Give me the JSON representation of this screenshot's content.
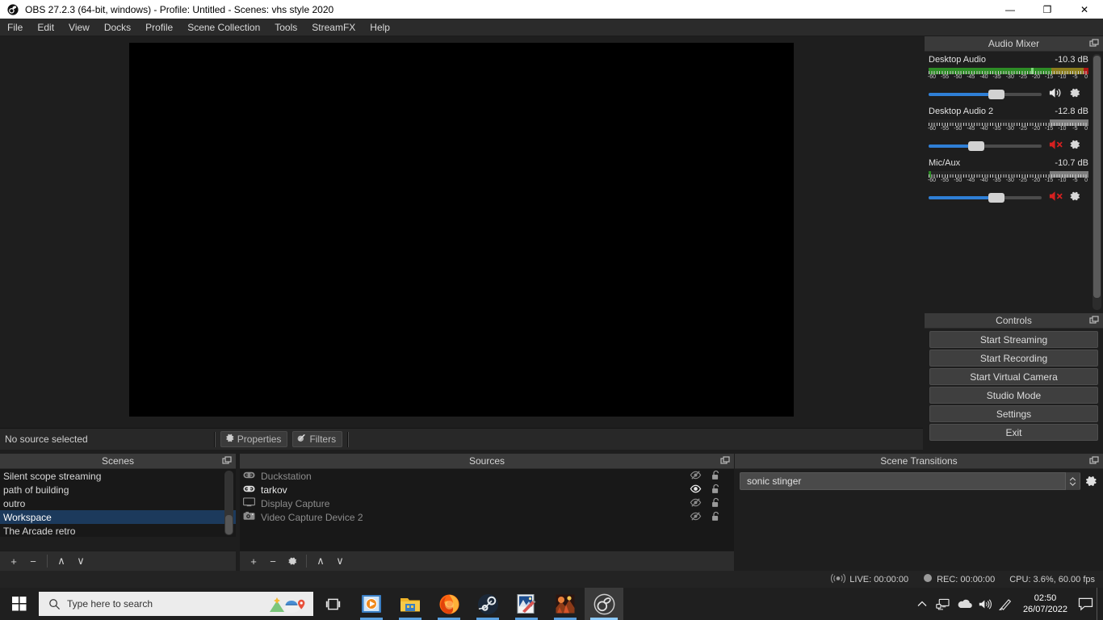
{
  "window": {
    "title": "OBS 27.2.3 (64-bit, windows) - Profile: Untitled - Scenes: vhs style 2020",
    "app_icon": "obs-logo-icon",
    "minimize": "—",
    "maximize": "❐",
    "close": "✕"
  },
  "menu": {
    "items": [
      {
        "label": "File"
      },
      {
        "label": "Edit"
      },
      {
        "label": "View"
      },
      {
        "label": "Docks"
      },
      {
        "label": "Profile"
      },
      {
        "label": "Scene Collection"
      },
      {
        "label": "Tools"
      },
      {
        "label": "StreamFX"
      },
      {
        "label": "Help"
      }
    ]
  },
  "source_toolbar": {
    "status": "No source selected",
    "properties_label": "Properties",
    "filters_label": "Filters"
  },
  "audio_mixer": {
    "title": "Audio Mixer",
    "sources": [
      {
        "name": "Desktop Audio",
        "db": "-10.3 dB",
        "muted": false,
        "volume_percent": 60,
        "meter": {
          "green_percent": 77,
          "yellow_start": 77,
          "yellow_end": 97,
          "red_start": 97,
          "peak_percent": 64
        }
      },
      {
        "name": "Desktop Audio 2",
        "db": "-12.8 dB",
        "muted": true,
        "volume_percent": 42,
        "meter": {
          "green_percent": 0,
          "grey_start": 76,
          "grey_end": 100
        }
      },
      {
        "name": "Mic/Aux",
        "db": "-10.7 dB",
        "muted": true,
        "volume_percent": 60,
        "meter": {
          "green_percent": 2,
          "grey_start": 76,
          "grey_end": 100
        }
      }
    ],
    "scale_labels": [
      "-60",
      "-55",
      "-50",
      "-45",
      "-40",
      "-35",
      "-30",
      "-25",
      "-20",
      "-15",
      "-10",
      "-5",
      "0"
    ]
  },
  "controls": {
    "title": "Controls",
    "buttons": [
      {
        "label": "Start Streaming"
      },
      {
        "label": "Start Recording"
      },
      {
        "label": "Start Virtual Camera"
      },
      {
        "label": "Studio Mode"
      },
      {
        "label": "Settings"
      },
      {
        "label": "Exit"
      }
    ]
  },
  "scenes": {
    "title": "Scenes",
    "items": [
      {
        "label": "Silent scope streaming",
        "selected": false
      },
      {
        "label": "path of building",
        "selected": false
      },
      {
        "label": "outro",
        "selected": false
      },
      {
        "label": "Workspace",
        "selected": true
      },
      {
        "label": "The Arcade retro",
        "selected": false
      }
    ],
    "toolbar": {
      "add": "+",
      "remove": "−",
      "up": "∧",
      "down": "∨"
    }
  },
  "sources": {
    "title": "Sources",
    "items": [
      {
        "label": "Duckstation",
        "icon": "game-capture-icon",
        "visible": false,
        "locked": false
      },
      {
        "label": "tarkov",
        "icon": "game-capture-icon",
        "visible": true,
        "locked": false
      },
      {
        "label": "Display Capture",
        "icon": "monitor-icon",
        "visible": false,
        "locked": false
      },
      {
        "label": "Video Capture Device 2",
        "icon": "camera-icon",
        "visible": false,
        "locked": false
      }
    ],
    "toolbar": {
      "add": "+",
      "remove": "−",
      "settings": "gear-icon",
      "up": "∧",
      "down": "∨"
    }
  },
  "transitions": {
    "title": "Scene Transitions",
    "selected": "sonic stinger",
    "properties_icon": "gear-icon"
  },
  "status_bar": {
    "live_label": "LIVE: 00:00:00",
    "rec_label": "REC: 00:00:00",
    "cpu_label": "CPU: 3.6%, 60.00 fps"
  },
  "taskbar": {
    "start_icon": "windows-logo-icon",
    "search_placeholder": "Type here to search",
    "taskview_icon": "task-view-icon",
    "apps": [
      {
        "name": "media-player-icon",
        "active": false,
        "running": true
      },
      {
        "name": "file-explorer-icon",
        "active": false,
        "running": true
      },
      {
        "name": "firefox-icon",
        "active": false,
        "running": true
      },
      {
        "name": "steam-icon",
        "active": false,
        "running": true
      },
      {
        "name": "photo-editor-icon",
        "active": false,
        "running": true
      },
      {
        "name": "game-icon",
        "active": false,
        "running": true
      },
      {
        "name": "obs-icon",
        "active": true,
        "running": true
      }
    ],
    "tray": [
      {
        "name": "show-hidden-icons-icon",
        "glyph": "∧"
      },
      {
        "name": "network-icon",
        "glyph": "⌸"
      },
      {
        "name": "onedrive-icon",
        "glyph": "☁"
      },
      {
        "name": "volume-icon",
        "glyph": "ὐA"
      },
      {
        "name": "pen-icon",
        "glyph": "✎"
      }
    ],
    "clock": {
      "time": "02:50",
      "date": "26/07/2022"
    },
    "notification_icon": "notification-icon"
  }
}
